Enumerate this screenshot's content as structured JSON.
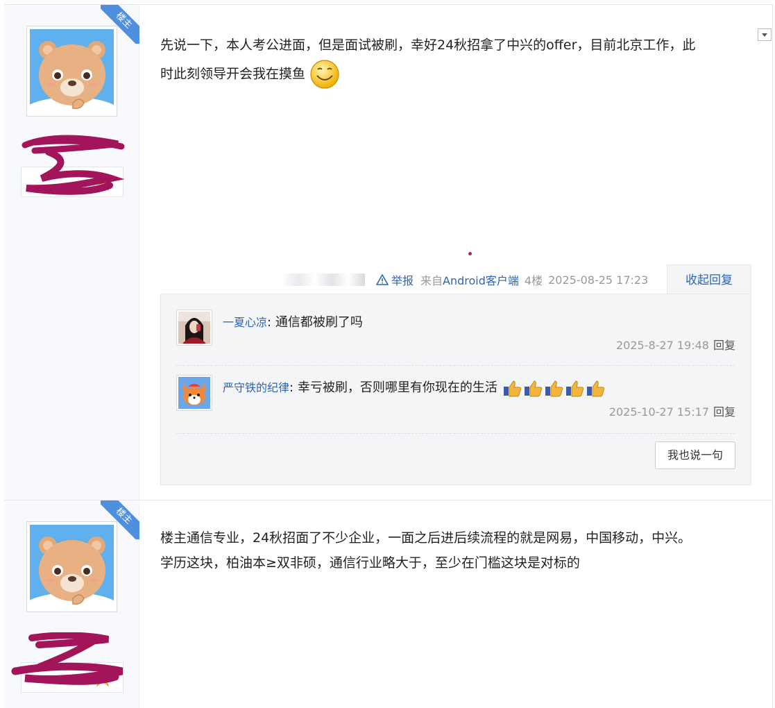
{
  "posts": [
    {
      "badge": "楼主",
      "content": [
        "先说一下，本人考公进面，但是面试被刷，幸好24秋招拿了中兴的offer，目前北京工作，此",
        "时此刻领导开会我在摸鱼"
      ],
      "tail": {
        "report": "举报",
        "client_prefix": "来自",
        "client": "Android客户端",
        "floor": "4楼",
        "time": "2025-08-25 17:23",
        "fold": "收起回复"
      },
      "replies": [
        {
          "user": "一夏心凉",
          "sep": ":",
          "text": " 通信都被刷了吗",
          "time": "2025-8-27 19:48",
          "reply": "回复"
        },
        {
          "user": "严守铁的纪律",
          "sep": ":",
          "text": " 幸亏被刷，否则哪里有你现在的生活",
          "time": "2025-10-27 15:17",
          "reply": "回复"
        }
      ],
      "say": "我也说一句"
    },
    {
      "badge": "楼主",
      "content": [
        "楼主通信专业，24秋招面了不少企业，一面之后进后续流程的就是网易，中国移动，中兴。",
        "学历这块，柏油本≥双非硕，通信行业略大于，至少在门槛这块是对标的"
      ]
    }
  ],
  "colors": {
    "link": "#2d64b3",
    "badge": "#4f8fe0",
    "scribble": "#a3155a"
  },
  "icons": [
    "bear-avatar-icon",
    "smiley-icon",
    "warning-icon",
    "thumbs-up-icon",
    "collapse-arrow-icon"
  ]
}
